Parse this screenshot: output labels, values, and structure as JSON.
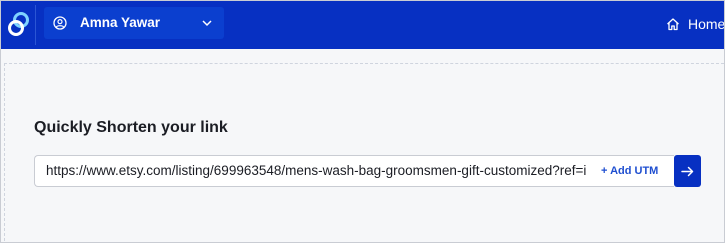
{
  "topbar": {
    "logo_icon": "app-logo-icon",
    "account": {
      "name": "Amna Yawar",
      "icon": "user-circle-icon",
      "dropdown_icon": "chevron-down-icon"
    },
    "home": {
      "label": "Home",
      "icon": "home-icon"
    }
  },
  "main": {
    "heading": "Quickly Shorten your link",
    "url_input": {
      "value": "https://www.etsy.com/listing/699963548/mens-wash-bag-groomsmen-gift-customized?ref=i"
    },
    "add_utm_label": "+ Add UTM",
    "submit_icon": "arrow-right-icon"
  },
  "colors": {
    "brand": "#0730c2",
    "link": "#1e4ed0",
    "background": "#f6f7f9"
  }
}
